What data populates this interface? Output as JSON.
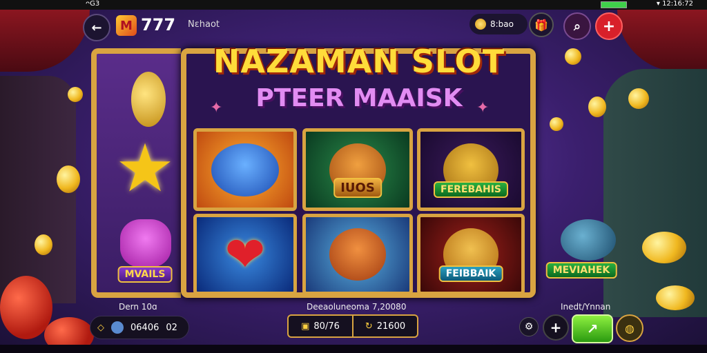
{
  "status_bar": {
    "left": "ᴖG3",
    "right": "▾ 12:16:72"
  },
  "header": {
    "logo_letter": "M",
    "logo_number": "777",
    "username": "Nɛhaot",
    "coins": "8:bao",
    "back_icon": "back-arrow-icon",
    "gift_icon": "gift-icon",
    "search_icon": "search-icon",
    "menu_icon": "plus-menu-icon"
  },
  "game": {
    "title": "NAZAMAN SLOT",
    "subtitle": "PTEER MAAISK",
    "reels": [
      {
        "symbol": "star",
        "glyph": "★",
        "color": "#f5c518"
      },
      {
        "symbol": "pink-cat",
        "glyph": "🐱",
        "banner": "MVAILS",
        "color": "#d84ad8"
      },
      {
        "symbol": "blue-cat",
        "glyph": "🐱",
        "color": "#3a7ad8"
      },
      {
        "symbol": "heart",
        "glyph": "❤",
        "color": "#e0202a"
      },
      {
        "symbol": "winged-cat",
        "glyph": "🐯",
        "banner": "IUOS",
        "color": "#e08a20"
      },
      {
        "symbol": "lion-cat",
        "glyph": "🦁",
        "color": "#e06a20"
      },
      {
        "symbol": "tiger-fish",
        "glyph": "🐯",
        "banner": "FEREBAHIS",
        "color": "#d8a030"
      },
      {
        "symbol": "winged-tiger",
        "glyph": "🐯",
        "banner": "FEIBBAIK",
        "color": "#e0a030"
      }
    ],
    "side_banner": "MEVIAHEK"
  },
  "footer": {
    "left_label": "Dern 10ɑ",
    "balance": "06406",
    "balance_extra": "02",
    "center_label": "Deeaoluneoma 7,20080",
    "win_value": "80/76",
    "win_total": "21600",
    "right_label": "Inedt/Ynnan",
    "spin_label": "↗"
  },
  "colors": {
    "frame_gold": "#d9a441",
    "title_yellow": "#ffdc3a",
    "subtitle_pink": "#e28cf2",
    "spin_green": "#5ad028",
    "menu_red": "#d8202a"
  }
}
